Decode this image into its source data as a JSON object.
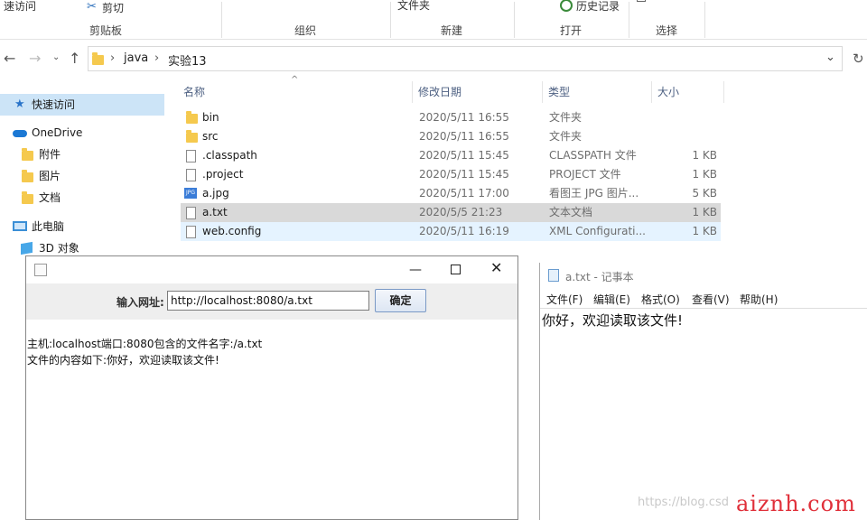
{
  "ribbon": {
    "recent_access": "速访问",
    "cut": "剪切",
    "folder": "文件夹",
    "history": "历史记录",
    "groups": [
      "剪贴板",
      "组织",
      "新建",
      "打开",
      "选择"
    ]
  },
  "address": {
    "crumbs": [
      "java",
      "实验13"
    ]
  },
  "nav": {
    "items": [
      {
        "label": "快速访问",
        "icon": "pin-icon",
        "indent": 0
      },
      {
        "label": "OneDrive",
        "icon": "cloud-icon",
        "indent": 0
      },
      {
        "label": "附件",
        "icon": "folder-icon",
        "indent": 1
      },
      {
        "label": "图片",
        "icon": "folder-icon",
        "indent": 1
      },
      {
        "label": "文档",
        "icon": "folder-icon",
        "indent": 1
      },
      {
        "label": "此电脑",
        "icon": "computer-icon",
        "indent": 0
      },
      {
        "label": "3D 对象",
        "icon": "cube-icon",
        "indent": 1
      }
    ]
  },
  "columns": {
    "name": "名称",
    "date": "修改日期",
    "type": "类型",
    "size": "大小"
  },
  "files": [
    {
      "name": "bin",
      "date": "2020/5/11 16:55",
      "type": "文件夹",
      "size": "",
      "icon": "folder-icon"
    },
    {
      "name": "src",
      "date": "2020/5/11 16:55",
      "type": "文件夹",
      "size": "",
      "icon": "folder-icon"
    },
    {
      "name": ".classpath",
      "date": "2020/5/11 15:45",
      "type": "CLASSPATH 文件",
      "size": "1 KB",
      "icon": "file-icon"
    },
    {
      "name": ".project",
      "date": "2020/5/11 15:45",
      "type": "PROJECT 文件",
      "size": "1 KB",
      "icon": "file-icon"
    },
    {
      "name": "a.jpg",
      "date": "2020/5/11 17:00",
      "type": "看图王 JPG 图片...",
      "size": "5 KB",
      "icon": "jpg-icon"
    },
    {
      "name": "a.txt",
      "date": "2020/5/5 21:23",
      "type": "文本文档",
      "size": "1 KB",
      "icon": "text-file-icon"
    },
    {
      "name": "web.config",
      "date": "2020/5/11 16:19",
      "type": "XML Configurati...",
      "size": "1 KB",
      "icon": "config-file-icon"
    }
  ],
  "java_window": {
    "label": "输入网址:",
    "url_value": "http://localhost:8080/a.txt",
    "ok_button": "确定",
    "line1": "主机:localhost端口:8080包含的文件名字:/a.txt",
    "line2": "文件的内容如下:你好，欢迎读取该文件!"
  },
  "notepad": {
    "title": "a.txt - 记事本",
    "menus": [
      "文件(F)",
      "编辑(E)",
      "格式(O)",
      "查看(V)",
      "帮助(H)"
    ],
    "content": "你好，欢迎读取该文件!"
  },
  "watermark": {
    "faint": "https://blog.csd",
    "site": "aiznh.com"
  }
}
